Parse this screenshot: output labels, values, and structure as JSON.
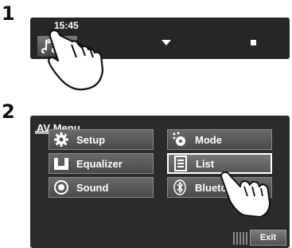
{
  "steps": [
    "1",
    "2"
  ],
  "screen1": {
    "clock": "15:45",
    "source_icon": "music-notes-gear-icon",
    "down_icon": "triangle-down-icon",
    "stop_icon": "square-icon"
  },
  "av_menu": {
    "title": "AV Menu",
    "buttons": [
      {
        "label": "Setup",
        "icon": "gear-icon"
      },
      {
        "label": "Mode",
        "icon": "mode-icon"
      },
      {
        "label": "Equalizer",
        "icon": "equalizer-icon"
      },
      {
        "label": "List",
        "icon": "list-icon",
        "selected": true
      },
      {
        "label": "Sound",
        "icon": "sound-icon"
      },
      {
        "label": "Bluetooth",
        "icon": "bluetooth-icon"
      }
    ],
    "exit_label": "Exit"
  }
}
